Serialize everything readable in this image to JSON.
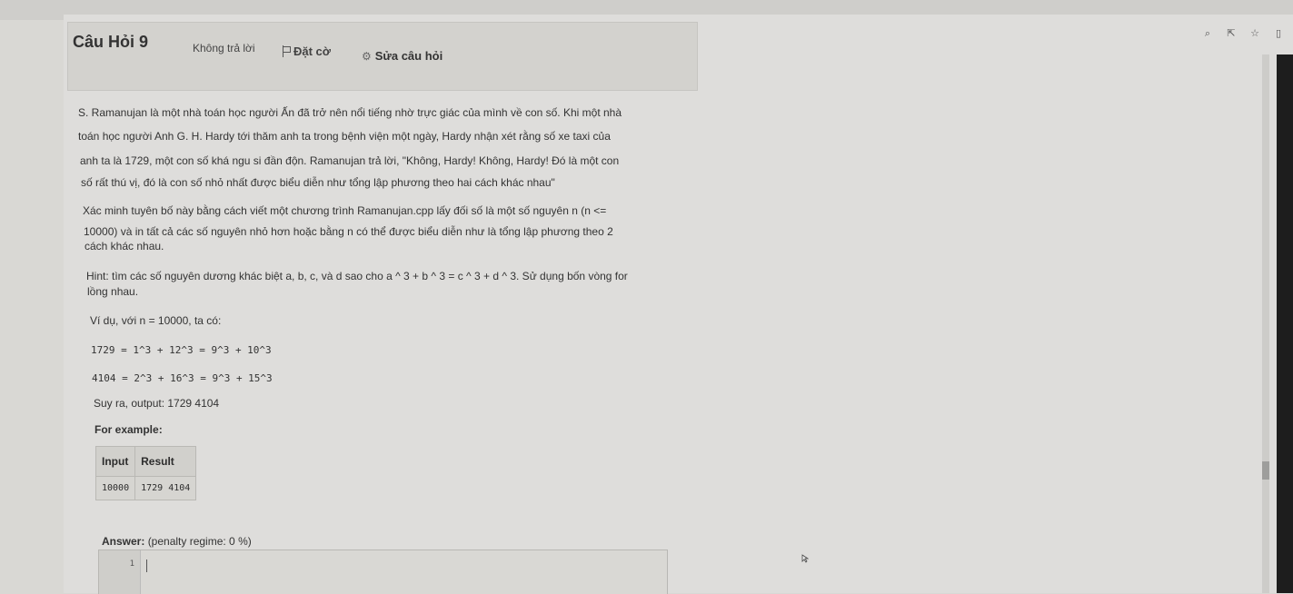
{
  "question": {
    "title": "Câu Hỏi 9",
    "state": "Không trả lời",
    "flag_label": "Đặt cờ",
    "edit_label": "Sửa câu hỏi"
  },
  "icons": {
    "toolbar": [
      "zoom-icon",
      "share-icon",
      "star-icon",
      "panel-icon"
    ],
    "flag": "flag-icon",
    "edit": "gear-icon"
  },
  "body": {
    "p1": [
      "S. Ramanujan là một nhà toán học người Ấn đã trở nên nổi tiếng nhờ trực giác của mình về con số. Khi một nhà",
      "toán học người Anh G. H. Hardy tới thăm anh ta trong bệnh viện một ngày, Hardy nhận xét rằng số xe taxi của",
      "anh ta là 1729, một con số khá ngu si đần độn. Ramanujan trả lời, \"Không, Hardy! Không, Hardy! Đó là một con",
      "số rất thú vị, đó là con số nhỏ nhất được biểu diễn như tổng lập phương theo hai cách khác nhau\""
    ],
    "p2": [
      "Xác minh tuyên bố này bằng cách viết một chương trình Ramanujan.cpp lấy đối số là một số nguyên n (n <=",
      "10000) và in tất cả các số nguyên nhỏ hơn hoặc bằng n có thể được biểu diễn như là tổng lập phương theo 2",
      "cách khác nhau."
    ],
    "p3": [
      "Hint:  tìm các số nguyên dương khác biệt a, b, c, và d sao cho a ^ 3 + b ^ 3 = c ^ 3 + d ^ 3. Sử dụng bốn vòng for",
      "lồng nhau."
    ],
    "example_intro": "Ví dụ, với n = 10000, ta có:",
    "eq1": "1729 = 1^3 + 12^3 = 9^3 + 10^3",
    "eq2": "4104 = 2^3 + 16^3 = 9^3 + 15^3",
    "conclusion": "Suy ra, output: 1729 4104",
    "for_example": "For example:"
  },
  "example_table": {
    "headers": [
      "Input",
      "Result"
    ],
    "rows": [
      [
        "10000",
        "1729 4104"
      ]
    ]
  },
  "answer": {
    "label": "Answer:",
    "penalty": "(penalty regime: 0 %)",
    "line_number": "1"
  }
}
